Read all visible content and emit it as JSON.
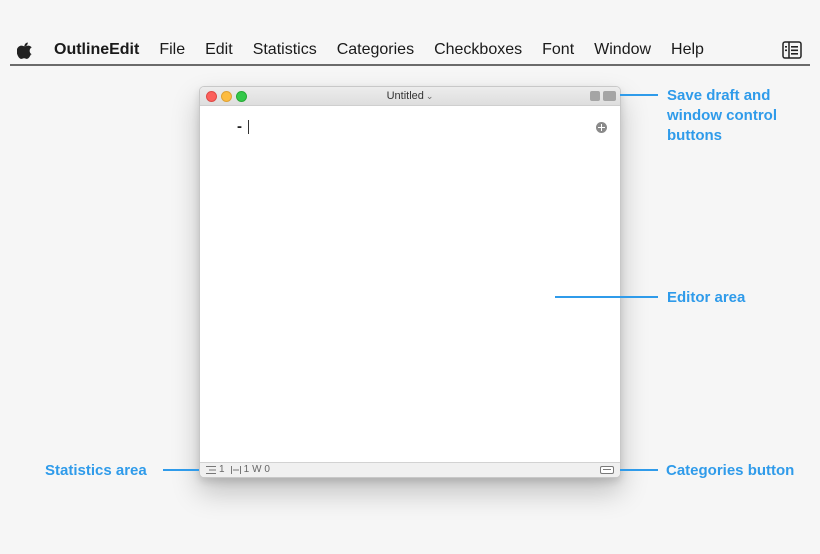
{
  "menubar": {
    "app_name": "OutlineEdit",
    "items": [
      "File",
      "Edit",
      "Statistics",
      "Categories",
      "Checkboxes",
      "Font",
      "Window",
      "Help"
    ]
  },
  "window": {
    "title": "Untitled",
    "editor": {
      "bullet": "-"
    },
    "status": {
      "lines": "1",
      "indent": "1",
      "words": "W 0"
    }
  },
  "annotations": {
    "save_line1": "Save draft and",
    "save_line2": "window control",
    "save_line3": "buttons",
    "editor_area": "Editor area",
    "statistics_area": "Statistics area",
    "categories_button": "Categories button"
  },
  "colors": {
    "accent": "#2f9bea",
    "close": "#fc605c",
    "minimize": "#fdbc40",
    "maximize": "#34c84a"
  },
  "icons": [
    "apple-icon",
    "sidebar-toggle-icon",
    "save-draft-icon",
    "fullscreen-icon",
    "add-icon",
    "lines-icon",
    "indent-icon",
    "categories-icon"
  ]
}
